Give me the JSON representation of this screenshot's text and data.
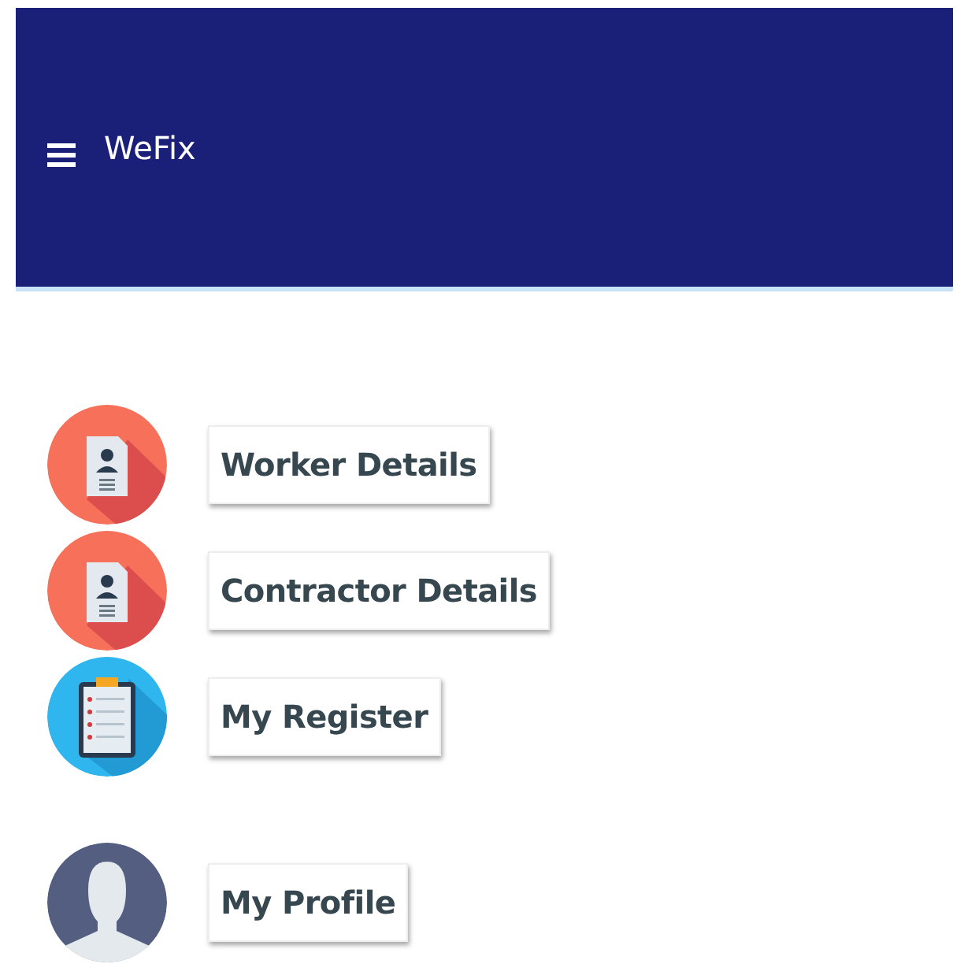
{
  "app_bar": {
    "title": "WeFix"
  },
  "menu_items": [
    {
      "label": "Worker Details",
      "kind": "resume"
    },
    {
      "label": "Contractor Details",
      "kind": "resume"
    },
    {
      "label": "My Register",
      "kind": "clipboard"
    },
    {
      "label": "My Profile",
      "kind": "person"
    }
  ]
}
